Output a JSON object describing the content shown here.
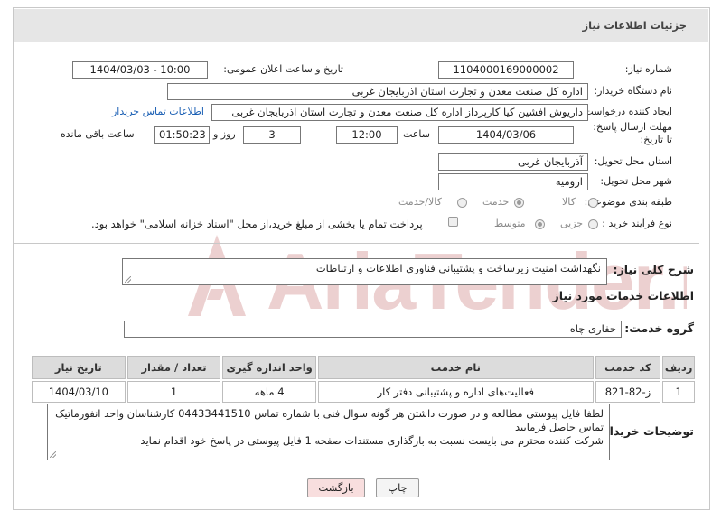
{
  "header": {
    "title": "جزئیات اطلاعات نیاز"
  },
  "form": {
    "need_number": {
      "label": "شماره نیاز:",
      "value": "1104000169000002"
    },
    "announce_datetime": {
      "label": "تاریخ و ساعت اعلان عمومی:",
      "value": "1404/03/03 - 10:00"
    },
    "buyer_org": {
      "label": "نام دستگاه خریدار:",
      "value": "اداره کل صنعت  معدن و تجارت استان اذربایجان غربی"
    },
    "requester": {
      "label": "ایجاد کننده درخواست:",
      "value": "داریوش افشین کیا کارپرداز اداره کل صنعت  معدن و تجارت استان اذربایجان غربی",
      "contact_link": "اطلاعات تماس خریدار"
    },
    "deadline": {
      "label": "مهلت ارسال پاسخ: تا تاریخ:",
      "date": "1404/03/06",
      "time_label": "ساعت",
      "time": "12:00",
      "days": "3",
      "days_label": "روز و",
      "remaining": "01:50:23",
      "remaining_label": "ساعت باقی مانده"
    },
    "province": {
      "label": "استان محل تحویل:",
      "value": "آذربایجان غربی"
    },
    "city": {
      "label": "شهر محل تحویل:",
      "value": "ارومیه"
    },
    "category": {
      "label": "طبقه بندی موضوعی:",
      "options": [
        "کالا",
        "خدمت",
        "کالا/خدمت"
      ],
      "selected": "خدمت"
    },
    "purchase_type": {
      "label": "نوع فرآیند خرید :",
      "options": [
        "جزیی",
        "متوسط"
      ],
      "selected": "متوسط",
      "treasury_note": "پرداخت تمام یا بخشی از مبلغ خرید،از محل \"اسناد خزانه اسلامی\" خواهد بود."
    }
  },
  "summary": {
    "label": "شرح کلی نیاز:",
    "value": "نگهداشت امنیت زیرساخت و پشتیبانی فناوری اطلاعات و ارتباطات"
  },
  "services": {
    "section_title": "اطلاعات خدمات مورد نیاز",
    "group_label": "گروه خدمت:",
    "group_value": "حفاری چاه",
    "columns": [
      "ردیف",
      "کد خدمت",
      "نام خدمت",
      "واحد اندازه گیری",
      "تعداد / مقدار",
      "تاریخ نیاز"
    ],
    "rows": [
      {
        "row": "1",
        "code": "ز-82-821",
        "name": "فعالیت‌های اداره و پشتیبانی دفتر کار",
        "unit": "4 ماهه",
        "qty": "1",
        "date": "1404/03/10"
      }
    ]
  },
  "buyer_notes": {
    "label": "توضیحات خریدار:",
    "lines": [
      "لطفا فایل پیوستی مطالعه و در صورت داشتن هر گونه سوال فنی با شماره تماس 04433441510 کارشناسان واحد انفورماتیک تماس حاصل فرمایید",
      "شرکت کننده محترم می بایست نسبت به بارگذاری مستندات صفحه 1 فایل پیوستی  در پاسخ خود اقدام نماید"
    ]
  },
  "buttons": {
    "print": "چاپ",
    "back": "بازگشت"
  },
  "watermark": {
    "text": "AriaTender.neT"
  },
  "colors": {
    "link": "#1a5fb4",
    "back_button_bg": "#f8dede",
    "header_bg": "#e6e6e6",
    "watermark": "#e9c9c9"
  }
}
